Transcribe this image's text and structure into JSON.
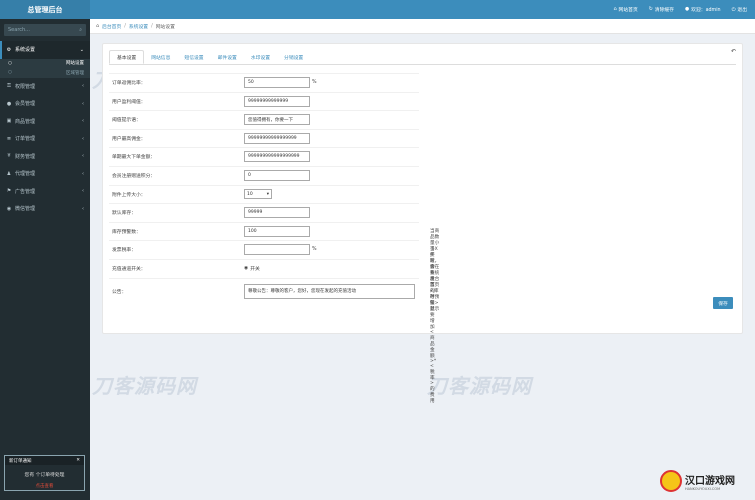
{
  "app": {
    "title": "总管理后台"
  },
  "sidebar": {
    "search_placeholder": "Search...",
    "menu": [
      {
        "label": "系统设置",
        "icon": "gear-icon",
        "active": true,
        "sub": [
          {
            "label": "网站设置",
            "on": true
          },
          {
            "label": "区域管理",
            "on": false
          }
        ]
      },
      {
        "label": "权限管理",
        "icon": "lock-icon"
      },
      {
        "label": "会员管理",
        "icon": "user-icon"
      },
      {
        "label": "商品管理",
        "icon": "box-icon"
      },
      {
        "label": "订单管理",
        "icon": "order-icon"
      },
      {
        "label": "财务管理",
        "icon": "money-icon"
      },
      {
        "label": "代理管理",
        "icon": "agent-icon"
      },
      {
        "label": "广告管理",
        "icon": "flag-icon"
      },
      {
        "label": "微信管理",
        "icon": "wechat-icon"
      }
    ],
    "notice": {
      "title": "新订单通知",
      "body": "您有  个订单待处理",
      "link": "点击查看"
    }
  },
  "topbar": {
    "home": "网站首页",
    "cache": "清除缓存",
    "welcome": "欢迎：admin",
    "logout": "退出"
  },
  "breadcrumb": {
    "items": [
      "后台首页",
      "系统设置",
      "网站设置"
    ]
  },
  "tabs": [
    "基本设置",
    "网站信息",
    "短信设置",
    "邮件设置",
    "水印设置",
    "分销设置"
  ],
  "form": {
    "rows": [
      {
        "label": "订单返佣比率：",
        "type": "input",
        "value": "50",
        "unit": "%",
        "width": 66
      },
      {
        "label": "用户盈利阈值：",
        "type": "input",
        "value": "99999999999999",
        "width": 66
      },
      {
        "label": "阈值提示语：",
        "type": "input",
        "value": "您值得拥有，你要一下",
        "width": 66
      },
      {
        "label": "用户最高佣金：",
        "type": "input",
        "value": "99999999999999999",
        "width": 66
      },
      {
        "label": "单期最大下单金额：",
        "type": "input",
        "value": "999999999999999999",
        "width": 66
      },
      {
        "label": "会员注册赠送积分：",
        "type": "input",
        "value": "0",
        "width": 66
      },
      {
        "label": "附件上传大小：",
        "type": "select",
        "value": "10"
      },
      {
        "label": "默认库存：",
        "type": "input",
        "value": "99999",
        "width": 66
      },
      {
        "label": "库存预警数：",
        "type": "input",
        "value": "100",
        "width": 66,
        "hint": "当商品数量小于X件时，会在系统后台首页<库存预警>显示"
      },
      {
        "label": "发票税率：",
        "type": "input",
        "value": "",
        "unit": "%",
        "width": 66,
        "hint": "当买家需要发票的时候就要增加<商品金额>*<税率>的费用"
      },
      {
        "label": "充值通道开关：",
        "type": "radio",
        "value": "开关"
      },
      {
        "label": "公告：",
        "type": "textarea",
        "value": "尊敬公告：尊敬的客户，您好，您现在发起的充值活动"
      }
    ],
    "save_label": "保存"
  },
  "watermark": "刀客源码网",
  "corner": {
    "title": "汉口游戏网",
    "sub": "HANKOUYOUXI.COM"
  }
}
